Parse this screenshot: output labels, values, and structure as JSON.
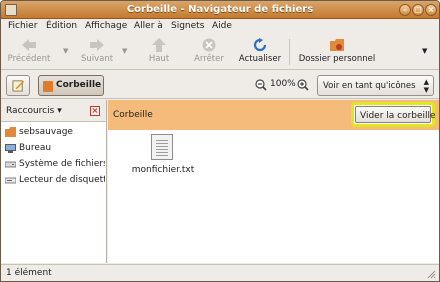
{
  "window": {
    "title": "Corbeille - Navigateur de fichiers"
  },
  "menu": [
    "Fichier",
    "Édition",
    "Affichage",
    "Aller à",
    "Signets",
    "Aide"
  ],
  "toolbar": {
    "back": "Précédent",
    "forward": "Suivant",
    "up": "Haut",
    "stop": "Arrêter",
    "reload": "Actualiser",
    "home": "Dossier personnel"
  },
  "location": {
    "crumb": "Corbeille",
    "zoom": "100%",
    "view": "Voir en tant qu'icônes"
  },
  "sidebar": {
    "header": "Raccourcis",
    "items": [
      {
        "label": "sebsauvage",
        "icon": "home-icon"
      },
      {
        "label": "Bureau",
        "icon": "desktop-icon"
      },
      {
        "label": "Système de fichiers",
        "icon": "drive-icon"
      },
      {
        "label": "Lecteur de disquette",
        "icon": "floppy-icon"
      }
    ]
  },
  "main": {
    "bar_title": "Corbeille",
    "empty_button": "Vider la corbeille",
    "files": [
      {
        "name": "monfichier.txt",
        "icon": "text-file-icon"
      }
    ]
  },
  "status": {
    "text": "1 élément"
  },
  "colors": {
    "titlebar": "#c47a2e",
    "trash_bar": "#f5bb7b",
    "highlight": "#e3e61e"
  }
}
